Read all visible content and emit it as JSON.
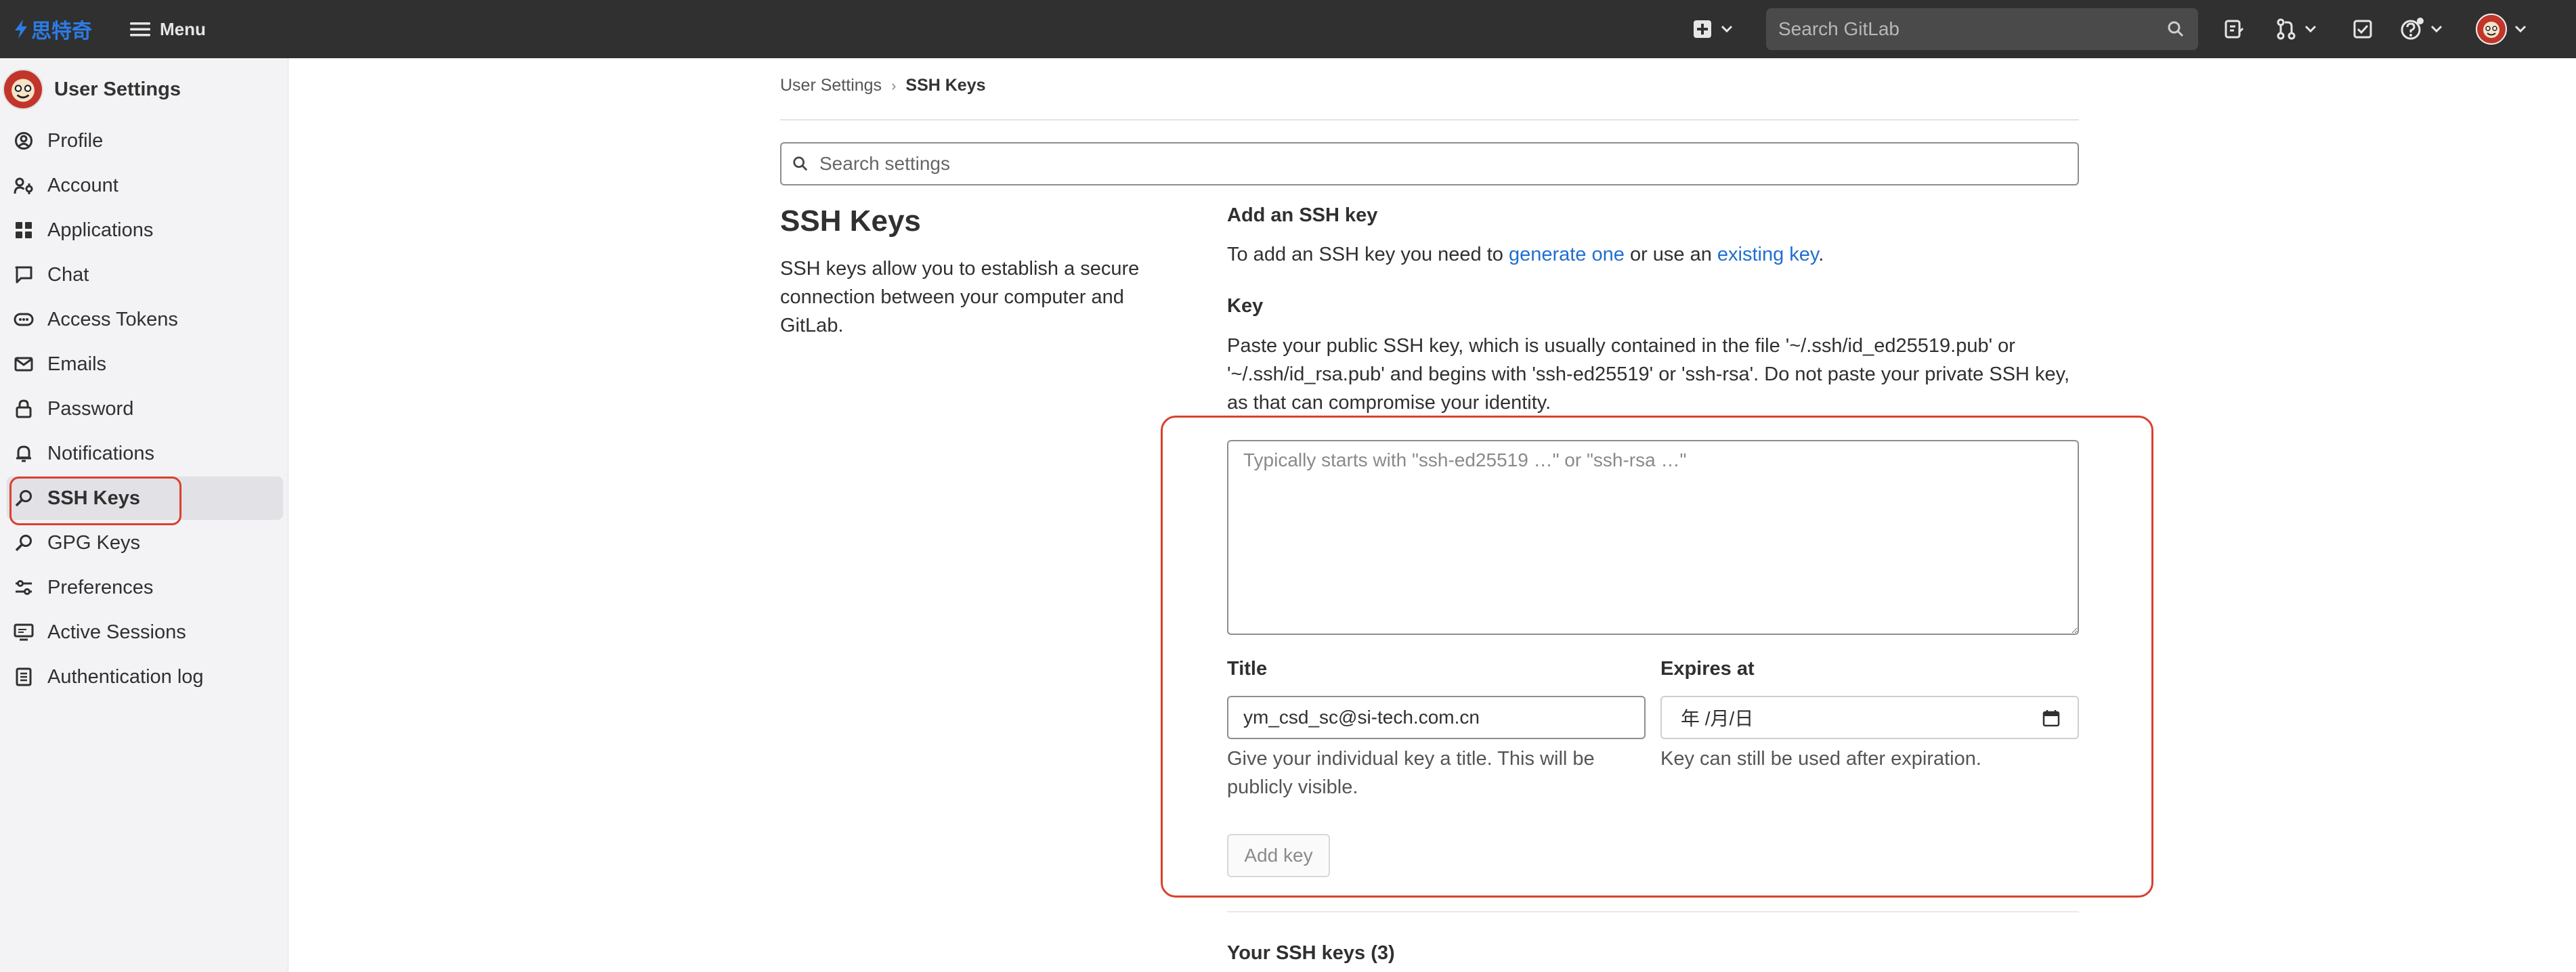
{
  "topbar": {
    "logo_text": "思特奇",
    "menu_label": "Menu",
    "search_placeholder": "Search GitLab",
    "icons": [
      "plus-square-icon",
      "chevron-down-icon",
      "issues-icon",
      "merge-request-icon",
      "todo-icon",
      "help-icon",
      "avatar"
    ]
  },
  "sidebar": {
    "title": "User Settings",
    "items": [
      {
        "label": "Profile",
        "icon": "profile-icon"
      },
      {
        "label": "Account",
        "icon": "account-icon"
      },
      {
        "label": "Applications",
        "icon": "applications-icon"
      },
      {
        "label": "Chat",
        "icon": "chat-icon"
      },
      {
        "label": "Access Tokens",
        "icon": "token-icon"
      },
      {
        "label": "Emails",
        "icon": "mail-icon"
      },
      {
        "label": "Password",
        "icon": "lock-icon"
      },
      {
        "label": "Notifications",
        "icon": "bell-icon"
      },
      {
        "label": "SSH Keys",
        "icon": "key-icon",
        "active": true
      },
      {
        "label": "GPG Keys",
        "icon": "key-icon"
      },
      {
        "label": "Preferences",
        "icon": "preferences-icon"
      },
      {
        "label": "Active Sessions",
        "icon": "monitor-icon"
      },
      {
        "label": "Authentication log",
        "icon": "log-icon"
      }
    ]
  },
  "breadcrumb": {
    "parent": "User Settings",
    "current": "SSH Keys"
  },
  "settings_search": {
    "placeholder": "Search settings"
  },
  "section": {
    "title": "SSH Keys",
    "description": "SSH keys allow you to establish a secure connection between your computer and GitLab."
  },
  "add_key": {
    "heading": "Add an SSH key",
    "intro_prefix": "To add an SSH key you need to ",
    "link_generate": "generate one",
    "intro_middle": " or use an ",
    "link_existing": "existing key",
    "intro_suffix": ".",
    "key_label": "Key",
    "key_help": "Paste your public SSH key, which is usually contained in the file '~/.ssh/id_ed25519.pub' or '~/.ssh/id_rsa.pub' and begins with 'ssh-ed25519' or 'ssh-rsa'. Do not paste your private SSH key, as that can compromise your identity.",
    "key_placeholder": "Typically starts with \"ssh-ed25519 …\" or \"ssh-rsa …\"",
    "title_label": "Title",
    "title_value": "ym_csd_sc@si-tech.com.cn",
    "title_help": "Give your individual key a title. This will be publicly visible.",
    "expires_label": "Expires at",
    "expires_value": "年 /月/日",
    "expires_help": "Key can still be used after expiration.",
    "add_button": "Add key"
  },
  "your_keys": {
    "heading": "Your SSH keys (3)"
  }
}
